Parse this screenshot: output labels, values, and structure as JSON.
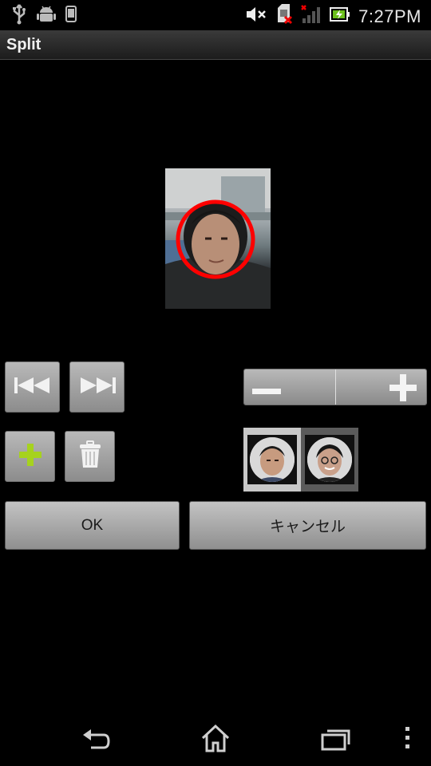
{
  "status_bar": {
    "time": "7:27PM",
    "icons": [
      "usb-icon",
      "android-debug-icon",
      "phone-icon",
      "mute-icon",
      "no-sim-icon",
      "signal-icon",
      "battery-charging-icon"
    ]
  },
  "title_bar": {
    "title": "Split"
  },
  "buttons": {
    "ok_label": "OK",
    "cancel_label": "キャンセル"
  },
  "icons": {
    "prev": "skip-previous-icon",
    "next": "skip-next-icon",
    "add": "plus-icon",
    "delete": "trash-icon",
    "zoom_out": "minus-icon",
    "zoom_in": "plus-icon"
  },
  "nav_bar": {
    "icons": [
      "back-icon",
      "home-icon",
      "recent-apps-icon",
      "menu-icon"
    ]
  },
  "colors": {
    "face_marker": "#ff0000",
    "add_icon": "#a6d21e",
    "button_gray": "#a5a5a5"
  }
}
